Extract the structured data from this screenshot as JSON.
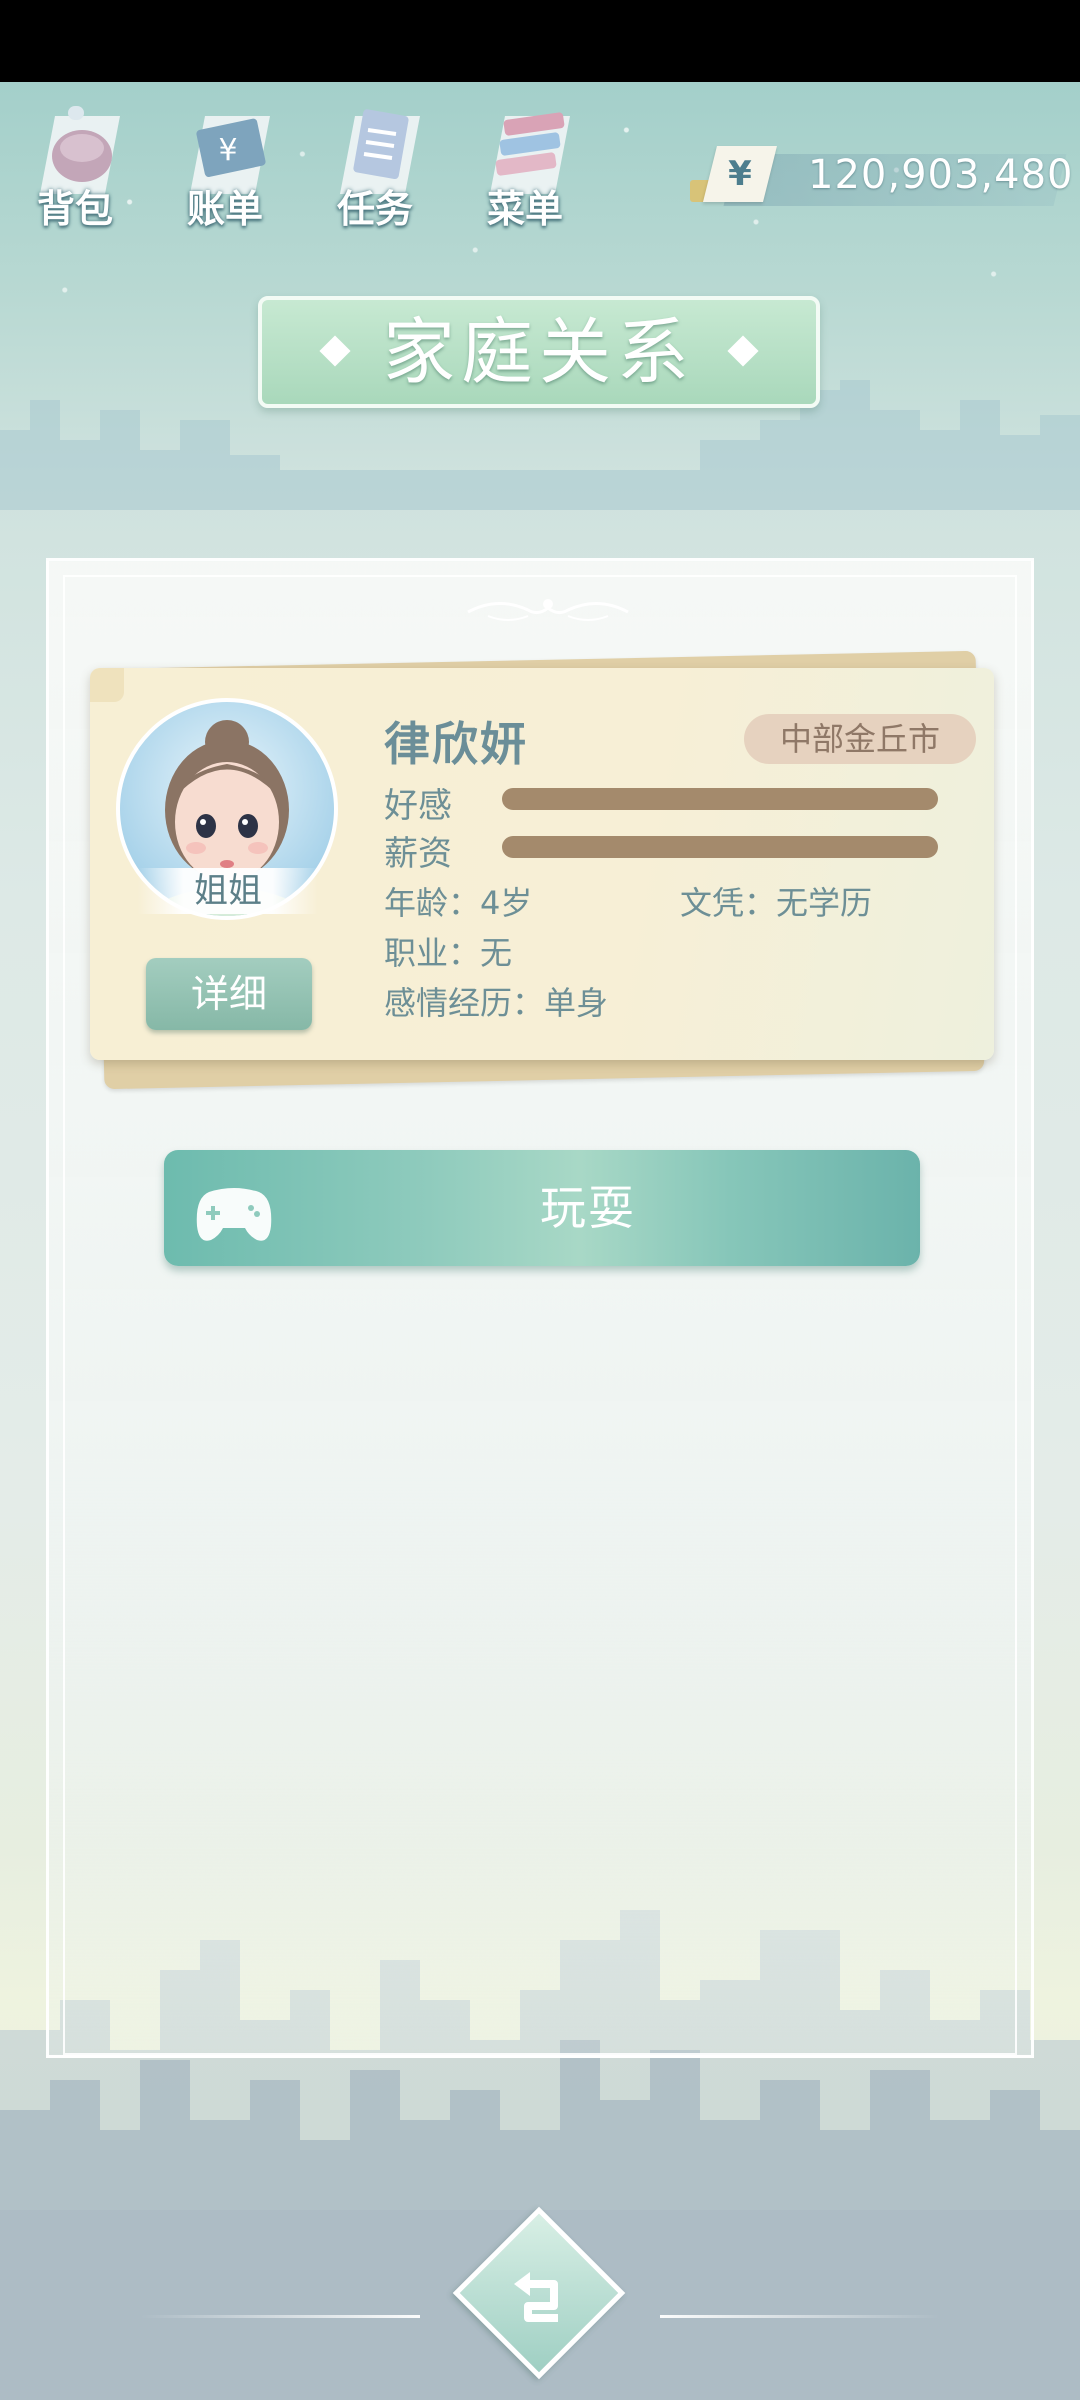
{
  "nav": {
    "items": [
      {
        "label": "背包",
        "icon": "bag-icon"
      },
      {
        "label": "账单",
        "icon": "bill-icon"
      },
      {
        "label": "任务",
        "icon": "task-icon"
      },
      {
        "label": "菜单",
        "icon": "menu-icon"
      }
    ]
  },
  "currency": {
    "symbol": "¥",
    "amount": "120,903,480"
  },
  "title": "家庭关系",
  "character": {
    "name": "律欣妍",
    "relation": "姐姐",
    "location": "中部金丘市",
    "detail_label": "详细",
    "stats": [
      {
        "label": "好感",
        "fill": 1.0
      },
      {
        "label": "薪资",
        "fill": 1.0
      }
    ],
    "age": "年龄：4岁",
    "education": "文凭：无学历",
    "job": "职业：无",
    "relationship": "感情经历：单身"
  },
  "play_button": {
    "label": "玩耍",
    "icon": "gamepad-icon"
  },
  "back_button": {
    "icon": "back-arrow-icon"
  },
  "colors": {
    "accent": "#86b8a7",
    "stat_bar": "#a48a6c",
    "card_bg": "#f7efd4",
    "play_button": "#8fcbbd"
  }
}
